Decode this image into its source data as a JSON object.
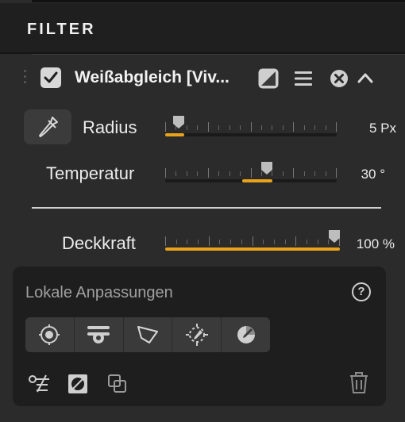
{
  "panel_title": "FILTER",
  "filter": {
    "name": "Weißabgleich [Viv...",
    "enabled": true,
    "icons": [
      "drag-handle-icon",
      "checkbox-icon",
      "mask-icon",
      "menu-icon",
      "close-circle-icon",
      "chevron-up-icon"
    ]
  },
  "sliders": {
    "radius": {
      "label": "Radius",
      "value_text": "5 Px",
      "level": 0.05
    },
    "temperatur": {
      "label": "Temperatur",
      "value_text": "30 °",
      "level": 0.6
    },
    "deckkraft": {
      "label": "Deckkraft",
      "value_text": "100 %",
      "level": 1.0
    }
  },
  "local_adjustments": {
    "title": "Lokale Anpassungen",
    "help": "?",
    "tools": [
      "control-point-icon",
      "gradient-icon",
      "polygon-icon",
      "auto-mask-icon",
      "color-picker-mask-icon"
    ],
    "bottom_icons": [
      "reset-mask-icon",
      "invert-mask-icon",
      "duplicate-icon",
      "trash-icon"
    ]
  },
  "colors": {
    "accent": "#e8a31a",
    "background": "#2b2b2b",
    "header": "#1f1f1f",
    "panel": "#1e1e1e"
  }
}
